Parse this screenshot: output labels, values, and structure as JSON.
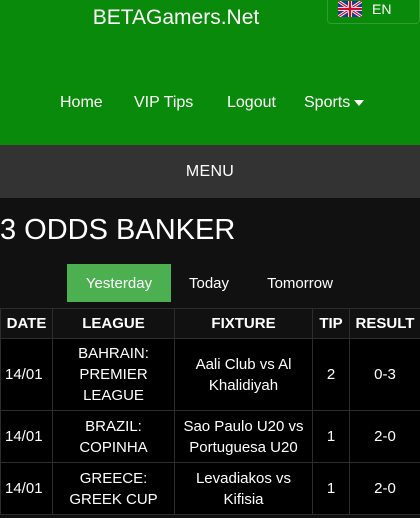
{
  "site": {
    "title": "BETAGamers.Net"
  },
  "lang": {
    "label": "EN",
    "flag_icon": "uk-flag-icon"
  },
  "nav": {
    "items": [
      {
        "label": "Home"
      },
      {
        "label": "VIP Tips"
      },
      {
        "label": "Logout"
      },
      {
        "label": "Sports"
      }
    ]
  },
  "menu": {
    "label": "MENU"
  },
  "page": {
    "title": "3 ODDS BANKER"
  },
  "tabs": [
    {
      "label": "Yesterday",
      "active": true
    },
    {
      "label": "Today",
      "active": false
    },
    {
      "label": "Tomorrow",
      "active": false
    }
  ],
  "table": {
    "headers": [
      "DATE",
      "LEAGUE",
      "FIXTURE",
      "TIP",
      "RESULT"
    ],
    "rows": [
      {
        "date": "14/01",
        "league": "BAHRAIN: PREMIER LEAGUE",
        "fixture": "Aali Club vs Al Khalidiyah",
        "tip": "2",
        "result": "0-3"
      },
      {
        "date": "14/01",
        "league": "BRAZIL: COPINHA",
        "fixture": "Sao Paulo U20 vs Portuguesa U20",
        "tip": "1",
        "result": "2-0"
      },
      {
        "date": "14/01",
        "league": "GREECE: GREEK CUP",
        "fixture": "Levadiakos vs Kifisia",
        "tip": "1",
        "result": "2-0"
      }
    ]
  },
  "colors": {
    "header_green": "#0a8a0a",
    "active_tab": "#4caf50",
    "menu_bar": "#333333",
    "background": "#111111"
  }
}
